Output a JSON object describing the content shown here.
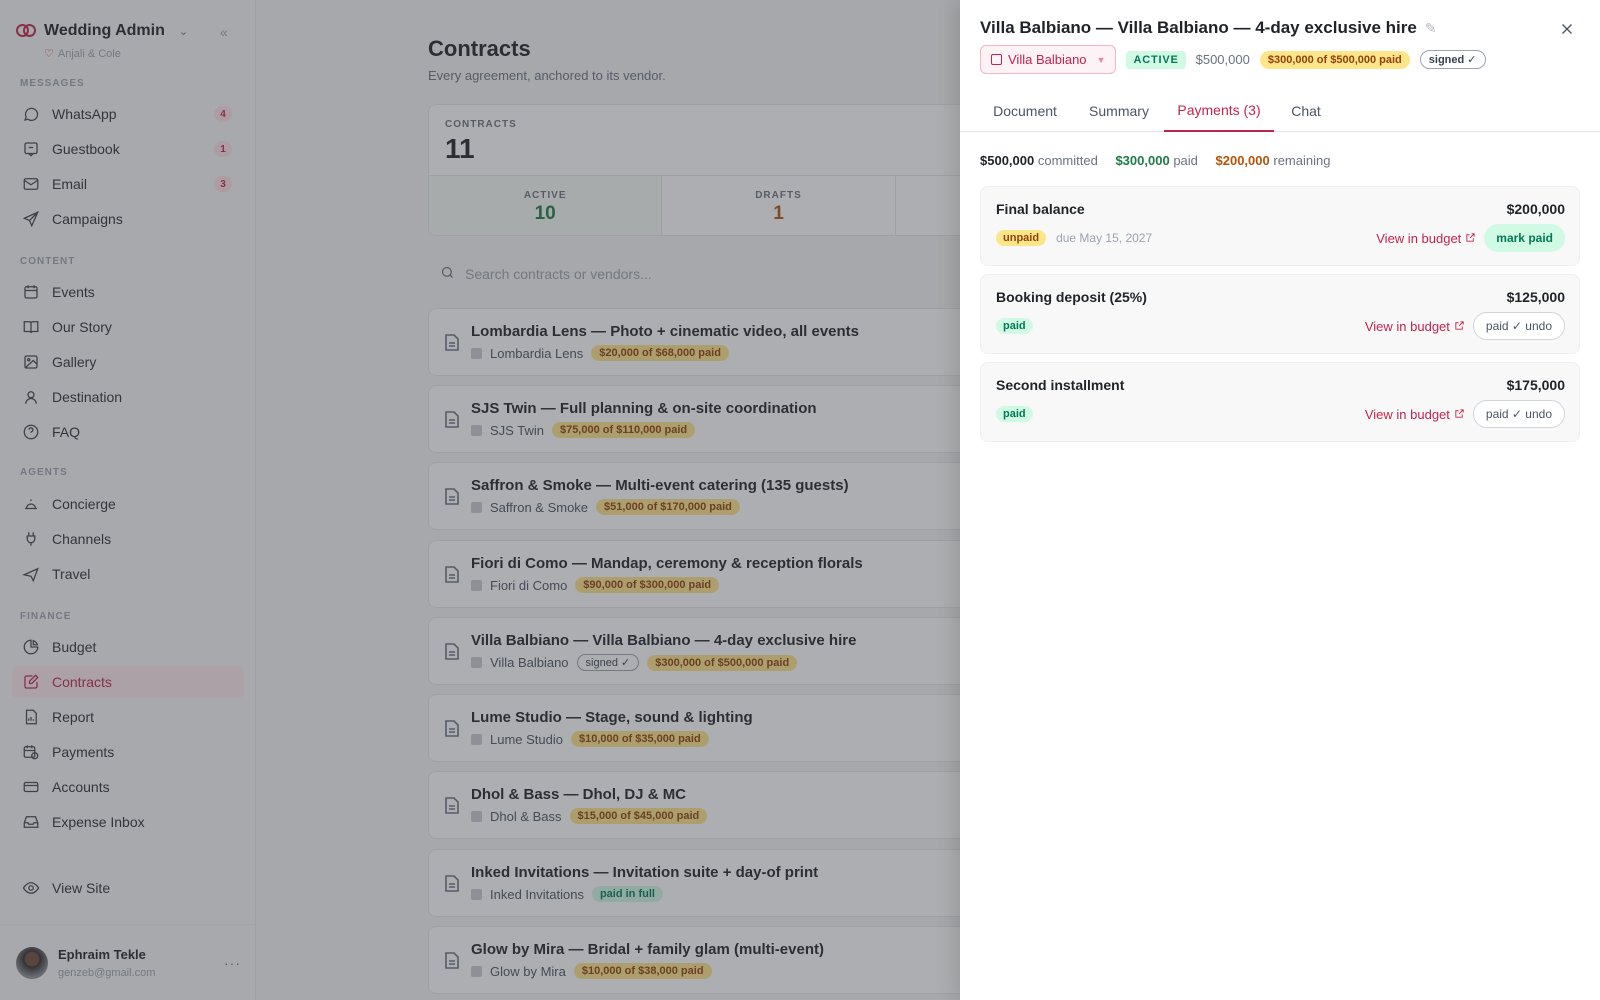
{
  "brand": {
    "title": "Wedding Admin",
    "subtitle": "Anjali & Cole"
  },
  "sections": {
    "messages": "MESSAGES",
    "content": "CONTENT",
    "agents": "AGENTS",
    "finance": "FINANCE"
  },
  "nav": {
    "whatsapp": {
      "label": "WhatsApp",
      "badge": "4"
    },
    "guestbook": {
      "label": "Guestbook",
      "badge": "1"
    },
    "email": {
      "label": "Email",
      "badge": "3"
    },
    "campaigns": {
      "label": "Campaigns"
    },
    "events": {
      "label": "Events"
    },
    "our_story": {
      "label": "Our Story"
    },
    "gallery": {
      "label": "Gallery"
    },
    "destination": {
      "label": "Destination"
    },
    "faq": {
      "label": "FAQ"
    },
    "concierge": {
      "label": "Concierge"
    },
    "channels": {
      "label": "Channels"
    },
    "travel": {
      "label": "Travel"
    },
    "budget": {
      "label": "Budget"
    },
    "contracts": {
      "label": "Contracts"
    },
    "report": {
      "label": "Report"
    },
    "payments": {
      "label": "Payments"
    },
    "accounts": {
      "label": "Accounts"
    },
    "expense_inbox": {
      "label": "Expense Inbox"
    },
    "view_site": {
      "label": "View Site"
    }
  },
  "user": {
    "name": "Ephraim Tekle",
    "email": "genzeb@gmail.com"
  },
  "main": {
    "title": "Contracts",
    "subtitle": "Every agreement, anchored to its vendor.",
    "stats": {
      "label": "CONTRACTS",
      "total": "11",
      "active_label": "ACTIVE",
      "active": "10",
      "drafts_label": "DRAFTS",
      "drafts": "1"
    },
    "search_placeholder": "Search contracts or vendors...",
    "contracts": [
      {
        "title": "Lombardia Lens — Photo + cinematic video, all events",
        "vendor": "Lombardia Lens",
        "paid": "$20,000 of $68,000 paid"
      },
      {
        "title": "SJS Twin — Full planning & on-site coordination",
        "vendor": "SJS Twin",
        "paid": "$75,000 of $110,000 paid"
      },
      {
        "title": "Saffron & Smoke — Multi-event catering (135 guests)",
        "vendor": "Saffron & Smoke",
        "paid": "$51,000 of $170,000 paid"
      },
      {
        "title": "Fiori di Como — Mandap, ceremony & reception florals",
        "vendor": "Fiori di Como",
        "paid": "$90,000 of $300,000 paid"
      },
      {
        "title": "Villa Balbiano — Villa Balbiano — 4-day exclusive hire",
        "vendor": "Villa Balbiano",
        "signed": "signed ✓",
        "paid": "$300,000 of $500,000 paid"
      },
      {
        "title": "Lume Studio — Stage, sound & lighting",
        "vendor": "Lume Studio",
        "paid": "$10,000 of $35,000 paid"
      },
      {
        "title": "Dhol & Bass — Dhol, DJ & MC",
        "vendor": "Dhol & Bass",
        "paid": "$15,000 of $45,000 paid"
      },
      {
        "title": "Inked Invitations — Invitation suite + day-of print",
        "vendor": "Inked Invitations",
        "full": "paid in full"
      },
      {
        "title": "Glow by Mira — Bridal + family glam (multi-event)",
        "vendor": "Glow by Mira",
        "paid": "$10,000 of $38,000 paid"
      }
    ]
  },
  "drawer": {
    "title": "Villa Balbiano — Villa Balbiano — 4-day exclusive hire",
    "vendor": "Villa Balbiano",
    "status": "ACTIVE",
    "amount": "$500,000",
    "paid_badge": "$300,000 of $500,000 paid",
    "signed": "signed ✓",
    "tabs": {
      "document": "Document",
      "summary": "Summary",
      "payments": "Payments (3)",
      "chat": "Chat"
    },
    "summary": {
      "committed_amt": "$500,000",
      "committed_lbl": "committed",
      "paid_amt": "$300,000",
      "paid_lbl": "paid",
      "remaining_amt": "$200,000",
      "remaining_lbl": "remaining"
    },
    "payments": [
      {
        "name": "Final balance",
        "amount": "$200,000",
        "status": "unpaid",
        "due": "due May 15, 2027",
        "link": "View in budget",
        "action": "mark paid"
      },
      {
        "name": "Booking deposit (25%)",
        "amount": "$125,000",
        "status": "paid",
        "link": "View in budget",
        "action": "paid ✓ undo"
      },
      {
        "name": "Second installment",
        "amount": "$175,000",
        "status": "paid",
        "link": "View in budget",
        "action": "paid ✓ undo"
      }
    ]
  },
  "colors": {
    "accent": "#c0264b",
    "success": "#047857",
    "warning": "#b45309"
  }
}
